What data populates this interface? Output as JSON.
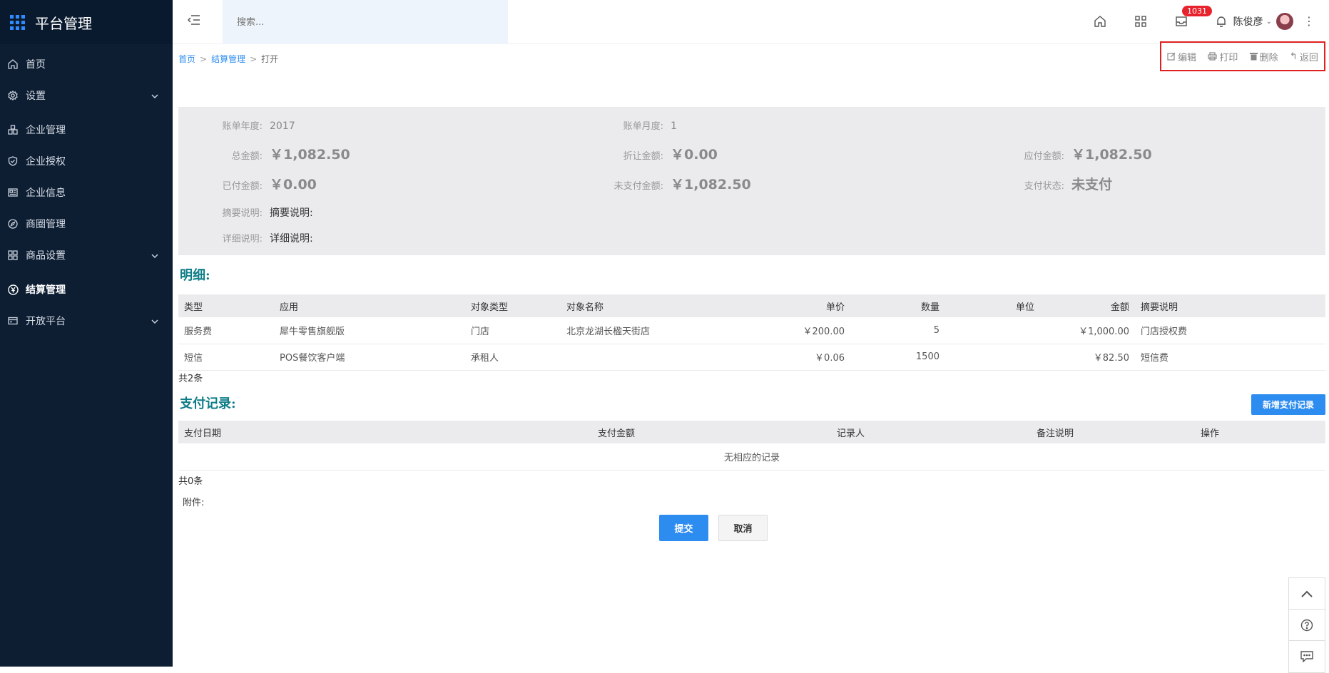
{
  "brand": {
    "title": "平台管理"
  },
  "sidebar": {
    "items": [
      {
        "label": "首页",
        "icon": "home-icon",
        "chevron": false,
        "active": false
      },
      {
        "label": "设置",
        "icon": "gear-icon",
        "chevron": true,
        "active": false
      },
      {
        "label": "企业管理",
        "icon": "blocks-icon",
        "chevron": false,
        "active": false
      },
      {
        "label": "企业授权",
        "icon": "shield-icon",
        "chevron": false,
        "active": false
      },
      {
        "label": "企业信息",
        "icon": "newspaper-icon",
        "chevron": false,
        "active": false
      },
      {
        "label": "商圈管理",
        "icon": "compass-icon",
        "chevron": false,
        "active": false
      },
      {
        "label": "商品设置",
        "icon": "grid-icon",
        "chevron": true,
        "active": false
      },
      {
        "label": "结算管理",
        "icon": "yen-circle-icon",
        "chevron": false,
        "active": true
      },
      {
        "label": "开放平台",
        "icon": "card-icon",
        "chevron": true,
        "active": false
      }
    ]
  },
  "topbar": {
    "search_placeholder": "搜索...",
    "badge_count": "1031",
    "user_name": "陈俊彦"
  },
  "breadcrumb": {
    "home": "首页",
    "parent": "结算管理",
    "current": "打开",
    "sep": ">"
  },
  "actions": {
    "edit": "编辑",
    "print": "打印",
    "delete": "删除",
    "back": "返回"
  },
  "summary": {
    "year_label": "账单年度:",
    "year_value": "2017",
    "month_label": "账单月度:",
    "month_value": "1",
    "total_label": "总金额:",
    "total_value": "￥1,082.50",
    "discount_label": "折让金额:",
    "discount_value": "￥0.00",
    "payable_label": "应付金额:",
    "payable_value": "￥1,082.50",
    "paid_label": "已付金额:",
    "paid_value": "￥0.00",
    "unpaid_label": "未支付金额:",
    "unpaid_value": "￥1,082.50",
    "status_label": "支付状态:",
    "status_value": "未支付",
    "abstract_label": "摘要说明:",
    "abstract_value": "摘要说明:",
    "detail_label": "详细说明:",
    "detail_value": "详细说明:"
  },
  "details": {
    "title": "明细:",
    "headers": [
      "类型",
      "应用",
      "对象类型",
      "对象名称",
      "单价",
      "数量",
      "单位",
      "金额",
      "摘要说明"
    ],
    "rows": [
      [
        "服务费",
        "犀牛零售旗舰版",
        "门店",
        "北京龙湖长楹天街店",
        "￥200.00",
        "5",
        "",
        "￥1,000.00",
        "门店授权费"
      ],
      [
        "短信",
        "POS餐饮客户端",
        "承租人",
        "",
        "￥0.06",
        "1500",
        "",
        "￥82.50",
        "短信费"
      ]
    ],
    "count": "共2条"
  },
  "payments": {
    "title": "支付记录:",
    "add_button": "新增支付记录",
    "headers": [
      "支付日期",
      "支付金额",
      "记录人",
      "备注说明",
      "操作"
    ],
    "empty": "无相应的记录",
    "count": "共0条"
  },
  "attachment_label": "附件:",
  "form": {
    "submit": "提交",
    "cancel": "取消"
  }
}
